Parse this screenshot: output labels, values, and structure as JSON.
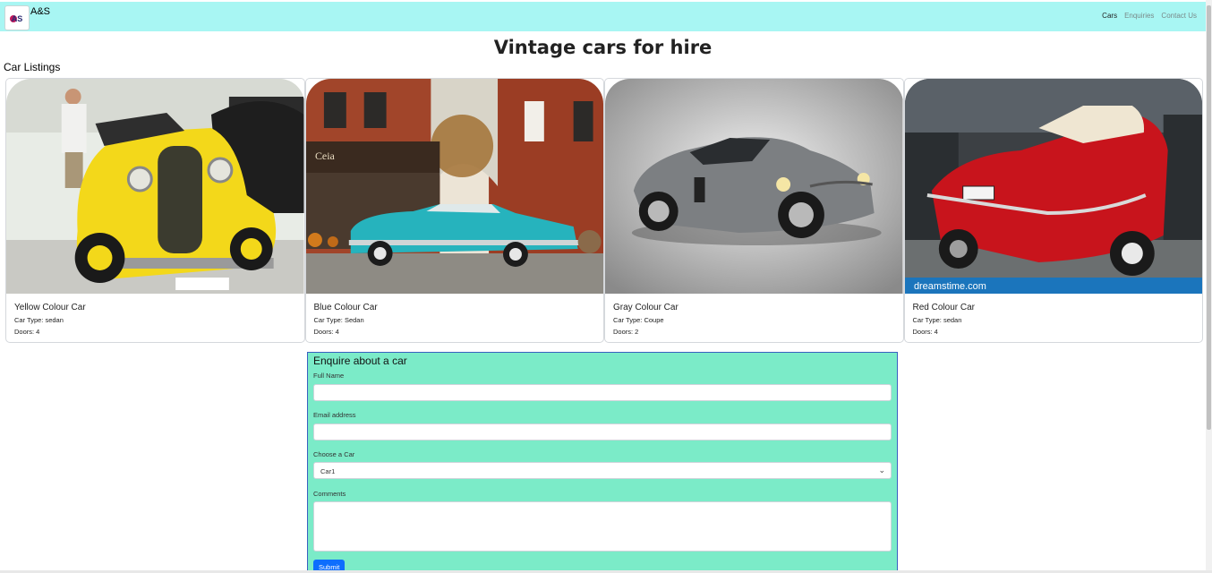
{
  "nav": {
    "brand": "A&S",
    "logo_text": "AS",
    "links": [
      "Cars",
      "Enquiries",
      "Contact Us"
    ]
  },
  "page_title": "Vintage cars for hire",
  "listings_title": "Car Listings",
  "cars": [
    {
      "name": "Yellow Colour Car",
      "type": "Car Type: sedan",
      "doors": "Doors: 4",
      "color": "#f3d81a"
    },
    {
      "name": "Blue Colour Car",
      "type": "Car Type: Sedan",
      "doors": "Doors: 4",
      "color": "#26b3bd"
    },
    {
      "name": "Gray Colour Car",
      "type": "Car Type: Coupe",
      "doors": "Doors: 2",
      "color": "#7c7f82"
    },
    {
      "name": "Red Colour Car",
      "type": "Car Type: sedan",
      "doors": "Doors: 4",
      "color": "#c8141c",
      "watermark": "dreamstime.com"
    }
  ],
  "form": {
    "title": "Enquire about a car",
    "full_name_label": "Full Name",
    "email_label": "Email address",
    "car_label": "Choose a Car",
    "car_selected": "Car1",
    "comments_label": "Comments",
    "submit_label": "Submit"
  },
  "colors": {
    "navbar": "#a8f6f3",
    "form_bg": "#7bebc8",
    "submit": "#0d6efd"
  }
}
